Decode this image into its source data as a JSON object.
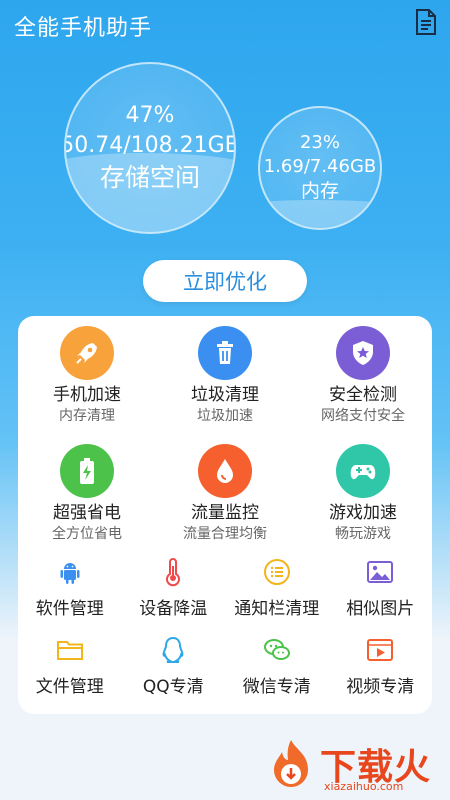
{
  "header": {
    "title": "全能手机助手",
    "doc_icon": "document-icon"
  },
  "storage": {
    "percent": "47%",
    "value": "50.74/108.21GB",
    "label": "存储空间",
    "fill": 0.47
  },
  "memory": {
    "percent": "23%",
    "value": "1.69/7.46GB",
    "label": "内存",
    "fill": 0.23
  },
  "optimize_button": "立即优化",
  "features": [
    {
      "label": "手机加速",
      "sub": "内存清理",
      "icon": "rocket-icon",
      "color": "#f7a23b"
    },
    {
      "label": "垃圾清理",
      "sub": "垃圾加速",
      "icon": "trash-icon",
      "color": "#3a8ff0"
    },
    {
      "label": "安全检测",
      "sub": "网络支付安全",
      "icon": "shield-icon",
      "color": "#7b5ed6"
    },
    {
      "label": "超强省电",
      "sub": "全方位省电",
      "icon": "battery-icon",
      "color": "#4cc24a"
    },
    {
      "label": "流量监控",
      "sub": "流量合理均衡",
      "icon": "drop-icon",
      "color": "#f5602e"
    },
    {
      "label": "游戏加速",
      "sub": "畅玩游戏",
      "icon": "gamepad-icon",
      "color": "#2fc7a8"
    }
  ],
  "tools": [
    {
      "label": "软件管理",
      "icon": "android-icon",
      "color": "#3a8ff0"
    },
    {
      "label": "设备降温",
      "icon": "thermometer-icon",
      "color": "#ef4b4b"
    },
    {
      "label": "通知栏清理",
      "icon": "list-icon",
      "color": "#f2b51c"
    },
    {
      "label": "相似图片",
      "icon": "image-icon",
      "color": "#7b5ed6"
    },
    {
      "label": "文件管理",
      "icon": "folder-icon",
      "color": "#f2b51c"
    },
    {
      "label": "QQ专清",
      "icon": "qq-icon",
      "color": "#2fa8e8"
    },
    {
      "label": "微信专清",
      "icon": "wechat-icon",
      "color": "#4cc24a"
    },
    {
      "label": "视频专清",
      "icon": "video-icon",
      "color": "#f5602e"
    }
  ],
  "watermark": {
    "text": "下载火",
    "url": "xiazaihuo.com"
  }
}
